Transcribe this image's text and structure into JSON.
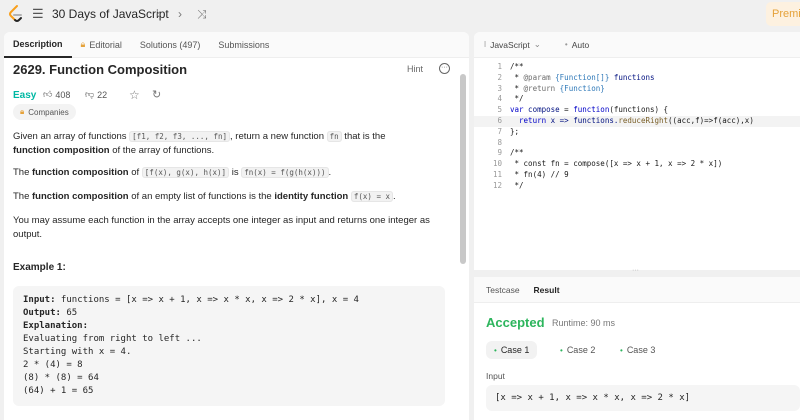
{
  "topbar": {
    "list_title": "30 Days of JavaScript",
    "premium_label": "Premium",
    "icons": {
      "logo": "leetcode-logo",
      "list": "list-icon",
      "prev": "chevron-left-icon",
      "next": "chevron-right-icon",
      "shuffle": "shuffle-icon"
    }
  },
  "tabs": {
    "description": "Description",
    "editorial": "Editorial",
    "solutions": "Solutions (497)",
    "submissions": "Submissions"
  },
  "problem": {
    "title": "2629. Function Composition",
    "hint": "Hint",
    "difficulty": "Easy",
    "likes": "408",
    "dislikes": "22",
    "companies": "Companies",
    "p1_a": "Given an array of functions ",
    "p1_code": "[f1, f2, f3, ..., fn]",
    "p1_b": ", return a new function ",
    "p1_code2": "fn",
    "p1_c": " that is the",
    "p1_bold": "function composition",
    "p1_d": " of the array of functions.",
    "p2_a": "The ",
    "p2_bold": "function composition",
    "p2_b": " of ",
    "p2_code": "[f(x), g(x), h(x)]",
    "p2_c": " is ",
    "p2_code2": "fn(x) = f(g(h(x)))",
    "p2_d": ".",
    "p3_a": "The ",
    "p3_bold": "function composition",
    "p3_b": " of an empty list of functions is the ",
    "p3_bold2": "identity function",
    "p3_c": " ",
    "p3_code": "f(x) = x",
    "p3_d": ".",
    "p4": "You may assume each function in the array accepts one integer as input and returns one integer as output.",
    "example_title": "Example 1:",
    "example": {
      "input_label": "Input:",
      "input_value": " functions = [x => x + 1, x => x * x, x => 2 * x], x = 4",
      "output_label": "Output:",
      "output_value": " 65",
      "explanation_label": "Explanation:",
      "lines": [
        "Evaluating from right to left ...",
        "Starting with x = 4.",
        "2 * (4) = 8",
        "(8) * (8) = 64",
        "(64) + 1 = 65"
      ]
    }
  },
  "editor": {
    "language": "JavaScript",
    "mode": "Auto",
    "line_numbers": [
      "1",
      "2",
      "3",
      "4",
      "5",
      "6",
      "7",
      "8",
      "9",
      "10",
      "11",
      "12"
    ],
    "code": {
      "l1": "/**",
      "l2a": " * ",
      "l2b": "@param",
      "l2c": " ",
      "l2d": "{Function[]}",
      "l2e": " functions",
      "l3a": " * ",
      "l3b": "@return",
      "l3c": " ",
      "l3d": "{Function}",
      "l4": " */",
      "l5a": "var",
      "l5b": " compose",
      "l5c": " = ",
      "l5d": "function",
      "l5e": "(functions) {",
      "l6a": "  ",
      "l6b": "return",
      "l6c": " x => functions.",
      "l6d": "reduceRight",
      "l6e": "((acc,f)=>f(acc),x)",
      "l7": "};",
      "l8": "",
      "l9": "/**",
      "l10": " * const fn = compose([x => x + 1, x => 2 * x])",
      "l11": " * fn(4) // 9",
      "l12": " */"
    }
  },
  "result": {
    "testcase_tab": "Testcase",
    "result_tab": "Result",
    "status": "Accepted",
    "runtime": "Runtime: 90 ms",
    "cases": [
      "Case 1",
      "Case 2",
      "Case 3"
    ],
    "input_label": "Input",
    "input_value": "[x => x + 1, x => x * x, x => 2 * x]"
  }
}
